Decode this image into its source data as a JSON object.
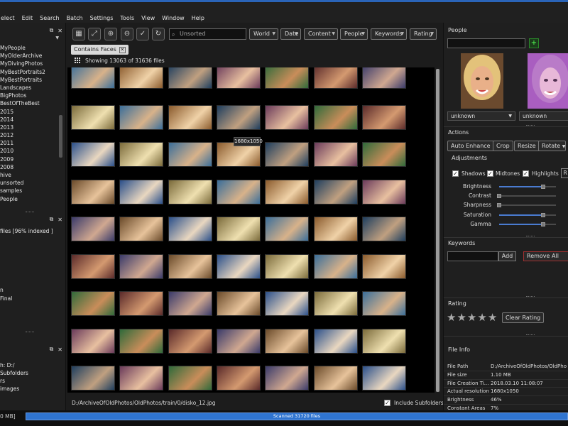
{
  "menu": [
    "elect",
    "Edit",
    "Search",
    "Batch",
    "Settings",
    "Tools",
    "View",
    "Window",
    "Help"
  ],
  "left": {
    "folders": [
      "MyPeople",
      "MyOlderArchive",
      "MyDivingPhotos",
      "MyBestPortraits2",
      "MyBestPortraits",
      "Landscapes",
      "BigPhotos",
      "BestOfTheBest",
      "2015",
      "2014",
      "2013",
      "2012",
      "2011",
      "2010",
      "2009",
      "2008",
      "hive",
      "unsorted",
      "samples",
      "People"
    ],
    "indexed": "files [96% indexed ]",
    "mid_items": [
      "n",
      "Final"
    ],
    "bottom_items": [
      "h: D:/",
      "Subfolders",
      "rs",
      "images"
    ]
  },
  "toolbar": {
    "search_placeholder": "Unsorted",
    "filters": [
      "World",
      "Date",
      "Content",
      "People",
      "Keywords",
      "Rating"
    ]
  },
  "chip": "Contains Faces",
  "showing": "Showing 13063 of 31636 files",
  "tooltip": "1680x1050",
  "path": "D:/ArchiveOfOldPhotos/OldPhotos/train/0/disko_12.jpg",
  "include_subfolders": "Include Subfolders",
  "right": {
    "people_title": "People",
    "face1_name": "unknown",
    "face2_name": "unknown",
    "actions_title": "Actions",
    "actions": [
      "Auto Enhance",
      "Crop",
      "Resize",
      "Rotate"
    ],
    "adjustments_title": "Adjustments",
    "checks": [
      "Shadows",
      "Midtones",
      "Highlights"
    ],
    "extra_btn": "R",
    "sliders": [
      {
        "label": "Brightness",
        "value": 0.78
      },
      {
        "label": "Contrast",
        "value": 0.0
      },
      {
        "label": "Sharpness",
        "value": 0.0
      },
      {
        "label": "Saturation",
        "value": 0.78
      },
      {
        "label": "Gamma",
        "value": 0.78
      }
    ],
    "keywords_title": "Keywords",
    "add": "Add",
    "remove_all": "Remove All",
    "rating_title": "Rating",
    "clear_rating": "Clear Rating",
    "fileinfo_title": "File Info",
    "fileinfo": [
      {
        "k": "File Path",
        "v": "D:/ArchiveOfOldPhotos/OldPho"
      },
      {
        "k": "File size",
        "v": "1.10 MB"
      },
      {
        "k": "File Creation Ti...",
        "v": "2018.03.10 11:08:07"
      },
      {
        "k": "Actual resolution",
        "v": "1680x1050"
      },
      {
        "k": "Brightness",
        "v": "46%"
      },
      {
        "k": "Constant Areas",
        "v": "7%"
      }
    ]
  },
  "status_left": "0 MB]",
  "progress_label": "Scanned 31720 files",
  "colors": {
    "accent": "#2f74d0",
    "window_border": "#2a64b8",
    "panel": "#1f1f1f"
  }
}
